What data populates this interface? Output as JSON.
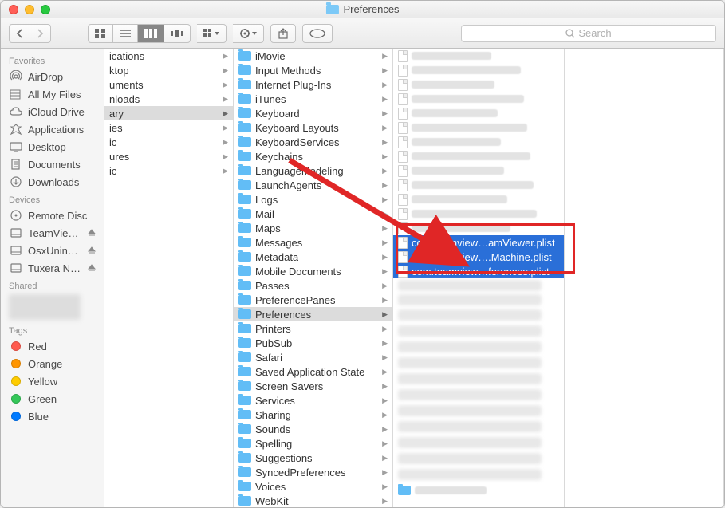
{
  "window": {
    "title": "Preferences"
  },
  "search": {
    "placeholder": "Search"
  },
  "sidebar": {
    "sections": [
      {
        "header": "Favorites",
        "items": [
          {
            "label": "AirDrop",
            "icon": "airdrop"
          },
          {
            "label": "All My Files",
            "icon": "allfiles"
          },
          {
            "label": "iCloud Drive",
            "icon": "icloud"
          },
          {
            "label": "Applications",
            "icon": "apps"
          },
          {
            "label": "Desktop",
            "icon": "desktop"
          },
          {
            "label": "Documents",
            "icon": "documents"
          },
          {
            "label": "Downloads",
            "icon": "downloads"
          }
        ]
      },
      {
        "header": "Devices",
        "items": [
          {
            "label": "Remote Disc",
            "icon": "remote"
          },
          {
            "label": "TeamVie…",
            "icon": "disk"
          },
          {
            "label": "OsxUnin…",
            "icon": "disk"
          },
          {
            "label": "Tuxera N…",
            "icon": "disk"
          }
        ]
      },
      {
        "header": "Shared",
        "items": []
      },
      {
        "header": "Tags",
        "items": [
          {
            "label": "Red",
            "color": "#ff5b4f"
          },
          {
            "label": "Orange",
            "color": "#ff9500"
          },
          {
            "label": "Yellow",
            "color": "#ffcc00"
          },
          {
            "label": "Green",
            "color": "#34c759"
          },
          {
            "label": "Blue",
            "color": "#007aff"
          }
        ]
      }
    ]
  },
  "col1": [
    {
      "label": "ications",
      "arrow": true
    },
    {
      "label": "ktop",
      "arrow": true
    },
    {
      "label": "uments",
      "arrow": true
    },
    {
      "label": "nloads",
      "arrow": true
    },
    {
      "label": "ary",
      "arrow": true,
      "selected": true
    },
    {
      "label": "ies",
      "arrow": true
    },
    {
      "label": "ic",
      "arrow": true
    },
    {
      "label": "ures",
      "arrow": true
    },
    {
      "label": "ic",
      "arrow": true
    }
  ],
  "col2": [
    "iMovie",
    "Input Methods",
    "Internet Plug-Ins",
    "iTunes",
    "Keyboard",
    "Keyboard Layouts",
    "KeyboardServices",
    "Keychains",
    "LanguageModeling",
    "LaunchAgents",
    "Logs",
    "Mail",
    "Maps",
    "Messages",
    "Metadata",
    "Mobile Documents",
    "Passes",
    "PreferencePanes",
    "Preferences",
    "Printers",
    "PubSub",
    "Safari",
    "Saved Application State",
    "Screen Savers",
    "Services",
    "Sharing",
    "Sounds",
    "Spelling",
    "Suggestions",
    "SyncedPreferences",
    "Voices",
    "WebKit"
  ],
  "col2_selected_index": 18,
  "col3_blur_rows": 13,
  "col3_selected": [
    "com.teamview…amViewer.plist",
    "com.teamview….Machine.plist",
    "com.teamview…ferences.plist"
  ],
  "col3_blur_rows_after": 14
}
